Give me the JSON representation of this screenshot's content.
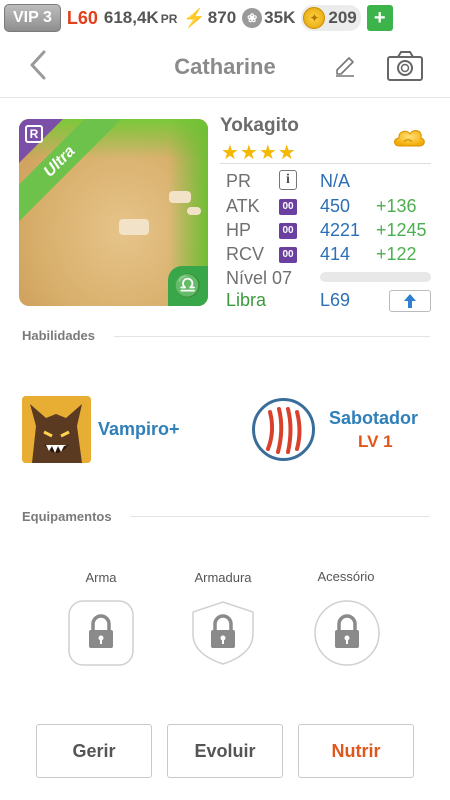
{
  "topbar": {
    "vip": "VIP 3",
    "level": "L60",
    "power": "618,4K",
    "power_unit": "PR",
    "stamina": "870",
    "paw_count": "35K",
    "coins": "209",
    "plus_label": "+"
  },
  "header": {
    "title": "Catharine"
  },
  "monster": {
    "rarity_letter": "R",
    "rarity_label": "Ultra",
    "sign_glyph": "♎",
    "name": "Yokagito",
    "stars": "★★★★",
    "element_icon": "cloud-icon",
    "stats": {
      "pr_label": "PR",
      "pr_info": "i",
      "pr_value": "N/A",
      "atk_label": "ATK",
      "atk_badge": "00",
      "atk_value": "450",
      "atk_bonus": "+136",
      "hp_label": "HP",
      "hp_badge": "00",
      "hp_value": "4221",
      "hp_bonus": "+1245",
      "rcv_label": "RCV",
      "rcv_badge": "00",
      "rcv_value": "414",
      "rcv_bonus": "+122"
    },
    "level_label": "Nível 07",
    "xp_fraction": 0,
    "sign_name": "Libra",
    "max_level": "L69"
  },
  "abilities": {
    "section_title": "Habilidades",
    "skill1_name": "Vampiro+",
    "skill2_name": "Sabotador",
    "skill2_level": "LV 1"
  },
  "equipment": {
    "section_title": "Equipamentos",
    "weapon_label": "Arma",
    "armor_label": "Armadura",
    "accessory_label": "Acessório"
  },
  "actions": {
    "manage": "Gerir",
    "evolve": "Evoluir",
    "feed": "Nutrir"
  },
  "colors": {
    "accent_blue": "#2f7fb8",
    "bonus_green": "#4caf50",
    "orange": "#e0561b",
    "rarity_purple": "#6b3fa0"
  }
}
